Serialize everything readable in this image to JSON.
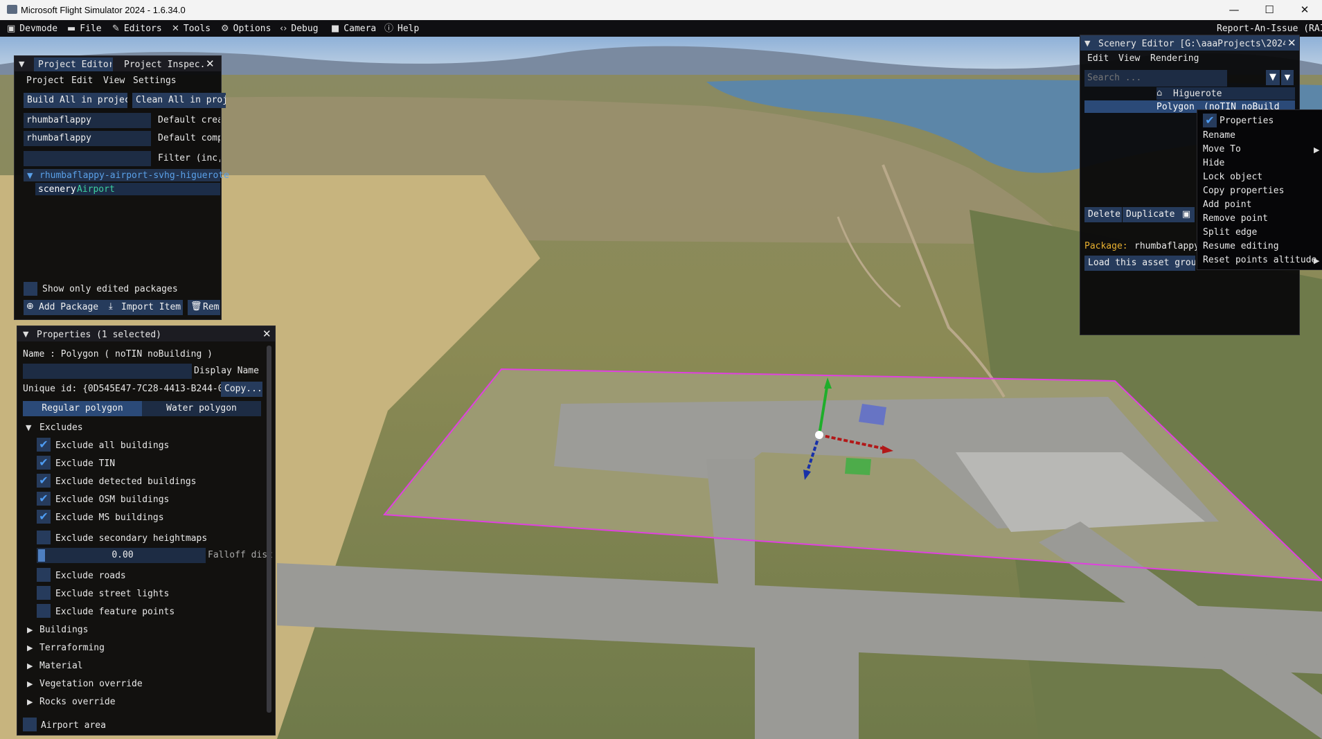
{
  "window": {
    "title": "Microsoft Flight Simulator 2024 - 1.6.34.0",
    "minimize": "—",
    "maximize": "☐",
    "close": "✕"
  },
  "devmode_menu": {
    "items": [
      {
        "label": "Devmode",
        "icon": "devmode-icon"
      },
      {
        "label": "File",
        "icon": "folder-icon"
      },
      {
        "label": "Editors",
        "icon": "pencil-icon"
      },
      {
        "label": "Tools",
        "icon": "tools-icon"
      },
      {
        "label": "Options",
        "icon": "gear-icon"
      },
      {
        "label": "Debug",
        "icon": "code-icon"
      },
      {
        "label": "Camera",
        "icon": "camera-icon"
      },
      {
        "label": "Help",
        "icon": "help-icon"
      }
    ],
    "report": "Report-An-Issue (RAI)"
  },
  "project_editor": {
    "tab1": "Project Editor...",
    "tab2": "Project Inspec...",
    "menu": [
      "Project",
      "Edit",
      "View",
      "Settings"
    ],
    "build_all": "Build All in project",
    "clean_all": "Clean All in proje",
    "creator_value": "rhumbaflappy",
    "creator_label": "Default creat",
    "company_value": "rhumbaflappy",
    "company_label": "Default compa",
    "filter_value": "",
    "filter_label": "Filter (inc,-",
    "tree_root": "rhumbaflappy-airport-svhg-higuerote",
    "tree_child_a": "scenery",
    "tree_child_b": "Airport",
    "show_only_edited": "Show only edited packages",
    "add_package": "Add Package",
    "import_item": "Import Item",
    "remove": "Rem"
  },
  "properties": {
    "title": "Properties (1 selected)",
    "name_line": "Name : Polygon  ( noTIN noBuilding )",
    "display_name_value": "",
    "display_name_label": "Display Name",
    "unique_id": "Unique id: {0D545E47-7C28-4413-B244-0260",
    "copy": "Copy...",
    "tab_regular": "Regular polygon",
    "tab_water": "Water polygon",
    "excludes_header": "Excludes",
    "excludes": [
      {
        "label": "Exclude all buildings",
        "checked": true
      },
      {
        "label": "Exclude TIN",
        "checked": true
      },
      {
        "label": "Exclude detected buildings",
        "checked": true
      },
      {
        "label": "Exclude OSM buildings",
        "checked": true
      },
      {
        "label": "Exclude MS buildings",
        "checked": true
      },
      {
        "label": "Exclude secondary heightmaps",
        "checked": false
      }
    ],
    "falloff_value": "0.00",
    "falloff_label": "Falloff dist",
    "excludes2": [
      {
        "label": "Exclude roads",
        "checked": false
      },
      {
        "label": "Exclude street lights",
        "checked": false
      },
      {
        "label": "Exclude feature points",
        "checked": false
      }
    ],
    "sections": [
      "Buildings",
      "Terraforming",
      "Material",
      "Vegetation override",
      "Rocks override"
    ],
    "airport_area": "Airport area"
  },
  "scenery_editor": {
    "title": "Scenery Editor [G:\\aaaProjects\\2024\\SV",
    "menu": [
      "Edit",
      "View",
      "Rendering"
    ],
    "search_placeholder": "Search ...",
    "tree_root": "Higuerote",
    "tree_selected": "Polygon",
    "tree_selected_suffix": "(noTIN noBuild",
    "delete": "Delete",
    "duplicate": "Duplicate",
    "package_label": "Package:",
    "package_value": "rhumbaflappy-",
    "load_asset_group": "Load this asset group"
  },
  "context_menu": {
    "items": [
      {
        "label": "Properties",
        "checked": true,
        "submenu": false
      },
      {
        "label": "Rename",
        "checked": false,
        "submenu": false
      },
      {
        "label": "Move To",
        "checked": false,
        "submenu": true
      },
      {
        "label": "Hide",
        "checked": false,
        "submenu": false
      },
      {
        "label": "Lock object",
        "checked": false,
        "submenu": false
      },
      {
        "label": "Copy properties",
        "checked": false,
        "submenu": false
      },
      {
        "label": "Add point",
        "checked": false,
        "submenu": false
      },
      {
        "label": "Remove point",
        "checked": false,
        "submenu": false
      },
      {
        "label": "Split edge",
        "checked": false,
        "submenu": false
      },
      {
        "label": "Resume editing",
        "checked": false,
        "submenu": false
      },
      {
        "label": "Reset points altitude",
        "checked": false,
        "submenu": true
      }
    ]
  },
  "colors": {
    "accent": "#263b5c",
    "check": "#4e9cf2",
    "polygon_outline": "#e040e0",
    "panel_bg": "#08080a",
    "package_label": "#e8b030"
  }
}
